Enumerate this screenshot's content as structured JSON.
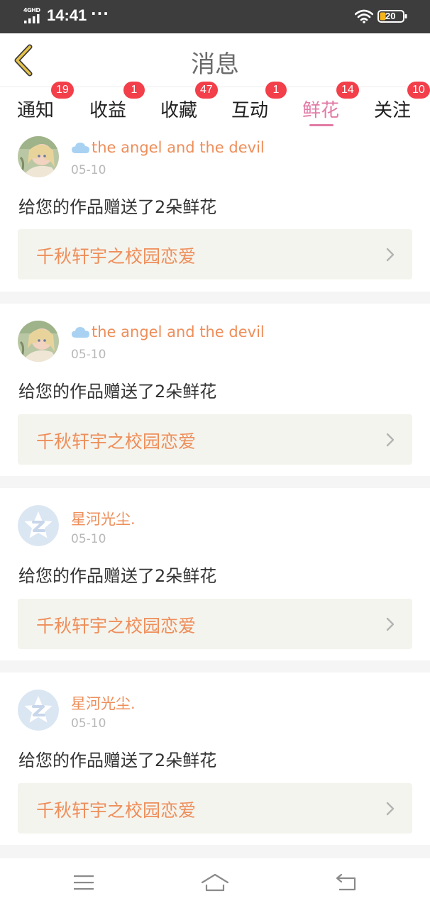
{
  "status_bar": {
    "network": "4GHD",
    "time": "14:41",
    "dots": "···",
    "battery": "20",
    "icons": [
      "signal-icon",
      "wifi-icon",
      "battery-icon"
    ]
  },
  "header": {
    "title": "消息",
    "back_icon": "chevron-left-icon"
  },
  "tabs": [
    {
      "label": "通知",
      "badge": "19",
      "active": false
    },
    {
      "label": "收益",
      "badge": "1",
      "active": false
    },
    {
      "label": "收藏",
      "badge": "47",
      "active": false
    },
    {
      "label": "互动",
      "badge": "1",
      "active": false
    },
    {
      "label": "鲜花",
      "badge": "14",
      "active": true
    },
    {
      "label": "关注",
      "badge": "10",
      "active": false
    }
  ],
  "messages": [
    {
      "user": "the angel and the devil",
      "has_cloud_icon": true,
      "avatar": "anime-avatar",
      "date": "05-10",
      "text": "给您的作品赠送了2朵鲜花",
      "work_title": "千秋轩宇之校园恋爱"
    },
    {
      "user": "the angel and the devil",
      "has_cloud_icon": true,
      "avatar": "anime-avatar",
      "date": "05-10",
      "text": "给您的作品赠送了2朵鲜花",
      "work_title": "千秋轩宇之校园恋爱"
    },
    {
      "user": "星河光尘.",
      "has_cloud_icon": false,
      "avatar": "default-z-avatar",
      "date": "05-10",
      "text": "给您的作品赠送了2朵鲜花",
      "work_title": "千秋轩宇之校园恋爱"
    },
    {
      "user": "星河光尘.",
      "has_cloud_icon": false,
      "avatar": "default-z-avatar",
      "date": "05-10",
      "text": "给您的作品赠送了2朵鲜花",
      "work_title": "千秋轩宇之校园恋爱"
    }
  ],
  "nav_bar": {
    "icons": [
      "menu-icon",
      "home-icon",
      "back-icon"
    ]
  },
  "colors": {
    "accent_pink": "#e27aa6",
    "username_orange": "#ee8e5a",
    "badge_red": "#f23f4a",
    "back_arrow": "#d6a93a"
  }
}
